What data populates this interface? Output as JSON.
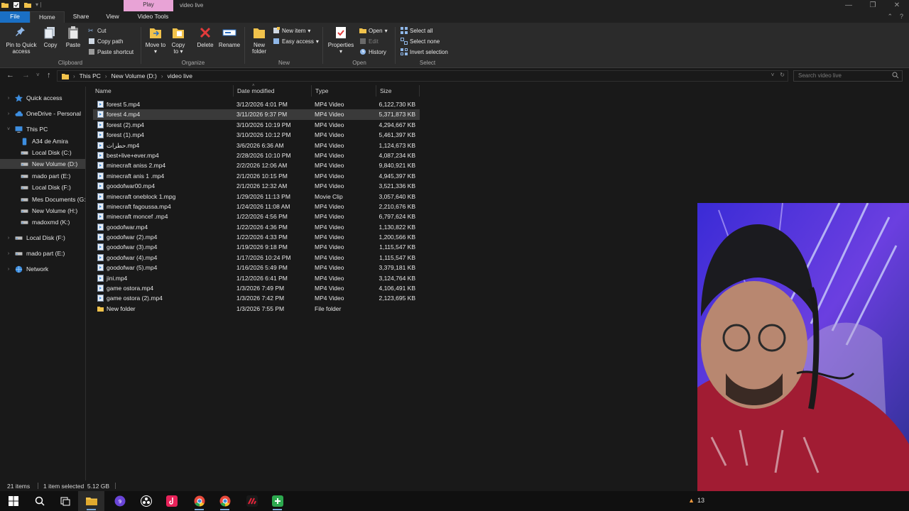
{
  "titlebar": {
    "context_tab": "Play",
    "window_title": "video live",
    "controls": [
      "—",
      "❐",
      "✕"
    ]
  },
  "ribbon_tabs": {
    "file": "File",
    "home": "Home",
    "share": "Share",
    "view": "View",
    "video_tools": "Video Tools"
  },
  "ribbon": {
    "clipboard": {
      "label": "Clipboard",
      "pin": "Pin to Quick access",
      "copy": "Copy",
      "paste": "Paste",
      "cut": "Cut",
      "copy_path": "Copy path",
      "paste_shortcut": "Paste shortcut"
    },
    "organize": {
      "label": "Organize",
      "move_to": "Move to",
      "copy_to": "Copy to",
      "delete": "Delete",
      "rename": "Rename"
    },
    "new": {
      "label": "New",
      "new_folder": "New folder",
      "new_item": "New item",
      "easy_access": "Easy access"
    },
    "open": {
      "label": "Open",
      "properties": "Properties",
      "open": "Open",
      "edit": "Edit",
      "history": "History"
    },
    "select": {
      "label": "Select",
      "select_all": "Select all",
      "select_none": "Select none",
      "invert_selection": "Invert selection"
    }
  },
  "address": {
    "crumbs": [
      "This PC",
      "New Volume (D:)",
      "video live"
    ],
    "search_placeholder": "Search video live"
  },
  "navpane": {
    "items": [
      {
        "label": "Quick access",
        "icon": "star-icon"
      },
      {
        "label": "OneDrive - Personal",
        "icon": "cloud-icon"
      },
      {
        "label": "This PC",
        "icon": "pc-icon"
      },
      {
        "label": "A34 de Amira",
        "icon": "phone-icon"
      },
      {
        "label": "Local Disk (C:)",
        "icon": "drive-icon"
      },
      {
        "label": "New Volume (D:)",
        "icon": "drive-icon"
      },
      {
        "label": "mado part (E:)",
        "icon": "drive-icon"
      },
      {
        "label": "Local Disk (F:)",
        "icon": "drive-icon"
      },
      {
        "label": "Mes Documents (G:",
        "icon": "drive-icon"
      },
      {
        "label": "New Volume (H:)",
        "icon": "drive-icon"
      },
      {
        "label": "madoxmd (K:)",
        "icon": "drive-icon"
      },
      {
        "label": "Local Disk (F:)",
        "icon": "drive-icon"
      },
      {
        "label": "mado part (E:)",
        "icon": "drive-icon"
      },
      {
        "label": "Network",
        "icon": "network-icon"
      }
    ]
  },
  "columns": {
    "name": "Name",
    "date": "Date modified",
    "type": "Type",
    "size": "Size"
  },
  "files": [
    {
      "name": "forest 5.mp4",
      "date": "3/12/2026 4:01 PM",
      "type": "MP4 Video",
      "size": "6,122,730 KB"
    },
    {
      "name": "forest 4.mp4",
      "date": "3/11/2026 9:37 PM",
      "type": "MP4 Video",
      "size": "5,371,873 KB"
    },
    {
      "name": "forest (2).mp4",
      "date": "3/10/2026 10:19 PM",
      "type": "MP4 Video",
      "size": "4,294,667 KB"
    },
    {
      "name": "forest (1).mp4",
      "date": "3/10/2026 10:12 PM",
      "type": "MP4 Video",
      "size": "5,461,397 KB"
    },
    {
      "name": "حطرات.mp4",
      "date": "3/6/2026 6:36 AM",
      "type": "MP4 Video",
      "size": "1,124,673 KB"
    },
    {
      "name": "best+live+ever.mp4",
      "date": "2/28/2026 10:10 PM",
      "type": "MP4 Video",
      "size": "4,087,234 KB"
    },
    {
      "name": "minecraft aniss 2.mp4",
      "date": "2/2/2026 12:06 AM",
      "type": "MP4 Video",
      "size": "9,840,921 KB"
    },
    {
      "name": "minecraft anis 1 .mp4",
      "date": "2/1/2026 10:15 PM",
      "type": "MP4 Video",
      "size": "4,945,397 KB"
    },
    {
      "name": "goodofwar00.mp4",
      "date": "2/1/2026 12:32 AM",
      "type": "MP4 Video",
      "size": "3,521,336 KB"
    },
    {
      "name": "minecraft oneblock 1.mpg",
      "date": "1/29/2026 11:13 PM",
      "type": "Movie Clip",
      "size": "3,057,640 KB"
    },
    {
      "name": "minecraft fagoussa.mp4",
      "date": "1/24/2026 11:08 AM",
      "type": "MP4 Video",
      "size": "2,210,676 KB"
    },
    {
      "name": "minecraft moncef .mp4",
      "date": "1/22/2026 4:56 PM",
      "type": "MP4 Video",
      "size": "6,797,624 KB"
    },
    {
      "name": "goodofwar.mp4",
      "date": "1/22/2026 4:36 PM",
      "type": "MP4 Video",
      "size": "1,130,822 KB"
    },
    {
      "name": "goodofwar (2).mp4",
      "date": "1/22/2026 4:33 PM",
      "type": "MP4 Video",
      "size": "1,200,566 KB"
    },
    {
      "name": "goodofwar (3).mp4",
      "date": "1/19/2026 9:18 PM",
      "type": "MP4 Video",
      "size": "1,115,547 KB"
    },
    {
      "name": "goodofwar (4).mp4",
      "date": "1/17/2026 10:24 PM",
      "type": "MP4 Video",
      "size": "1,115,547 KB"
    },
    {
      "name": "goodofwar (5).mp4",
      "date": "1/16/2026 5:49 PM",
      "type": "MP4 Video",
      "size": "3,379,181 KB"
    },
    {
      "name": "jini.mp4",
      "date": "1/12/2026 6:41 PM",
      "type": "MP4 Video",
      "size": "3,124,764 KB"
    },
    {
      "name": "game ostora.mp4",
      "date": "1/3/2026 7:49 PM",
      "type": "MP4 Video",
      "size": "4,106,491 KB"
    },
    {
      "name": "game ostora (2).mp4",
      "date": "1/3/2026 7:42 PM",
      "type": "MP4 Video",
      "size": "2,123,695 KB"
    },
    {
      "name": "New folder",
      "date": "1/3/2026 7:55 PM",
      "type": "File folder",
      "size": ""
    }
  ],
  "status": {
    "count": "21 items",
    "selected": "1 item selected  5.12 GB"
  },
  "taskbar": {
    "tray_count": "13"
  },
  "colors": {
    "accent": "#1a6fc4",
    "folder": "#f1c24b",
    "delete": "#e23b3b",
    "context_tab": "#e8a3d6"
  }
}
